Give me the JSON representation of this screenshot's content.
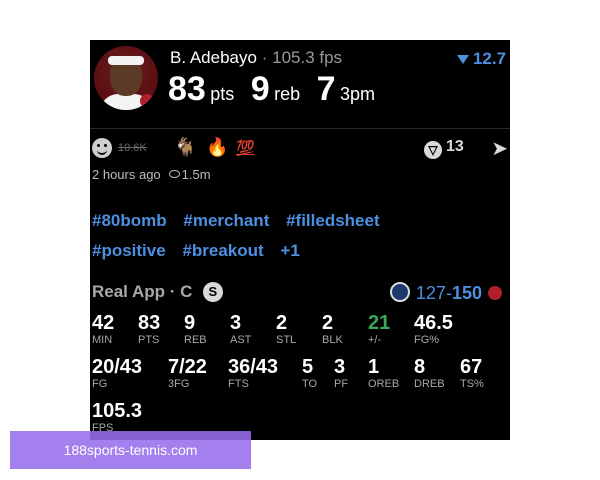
{
  "header": {
    "player_name": "B. Adebayo",
    "separator": "·",
    "fps_label": "105.3 fps",
    "trend_value": "12.7",
    "pts_value": "83",
    "pts_unit": "pts",
    "reb_value": "9",
    "reb_unit": "reb",
    "three_value": "7",
    "three_unit": "3pm"
  },
  "reactions": {
    "strike_count": "10.6K",
    "emoji_1": "🐐",
    "emoji_2": "🔥",
    "emoji_3": "💯",
    "vote_count": "13",
    "time_ago": "2 hours ago",
    "views": "1.5m"
  },
  "hashtags": [
    "#80bomb",
    "#merchant",
    "#filledsheet",
    "#positive",
    "#breakout",
    "+1"
  ],
  "game": {
    "app_label": "Real App · C",
    "badge": "S",
    "score_away": "127",
    "score_dash": "-",
    "score_home": "150"
  },
  "stats": {
    "row1": [
      {
        "value": "42",
        "label": "MIN"
      },
      {
        "value": "83",
        "label": "PTS"
      },
      {
        "value": "9",
        "label": "REB"
      },
      {
        "value": "3",
        "label": "AST"
      },
      {
        "value": "2",
        "label": "STL"
      },
      {
        "value": "2",
        "label": "BLK"
      },
      {
        "value": "21",
        "label": "+/-"
      },
      {
        "value": "46.5",
        "label": "FG%"
      }
    ],
    "row2": [
      {
        "value": "20/43",
        "label": "FG"
      },
      {
        "value": "7/22",
        "label": "3FG"
      },
      {
        "value": "36/43",
        "label": "FTS"
      },
      {
        "value": "5",
        "label": "TO"
      },
      {
        "value": "3",
        "label": "PF"
      },
      {
        "value": "1",
        "label": "OREB"
      },
      {
        "value": "8",
        "label": "DREB"
      },
      {
        "value": "67",
        "label": "TS%"
      }
    ],
    "row3": [
      {
        "value": "105.3",
        "label": "FPS"
      }
    ]
  },
  "colors": {
    "accent_blue": "#4d8fe0",
    "plus_minus_green": "#3aa85a",
    "background": "#000000"
  },
  "watermark": "188sports-tennis.com"
}
